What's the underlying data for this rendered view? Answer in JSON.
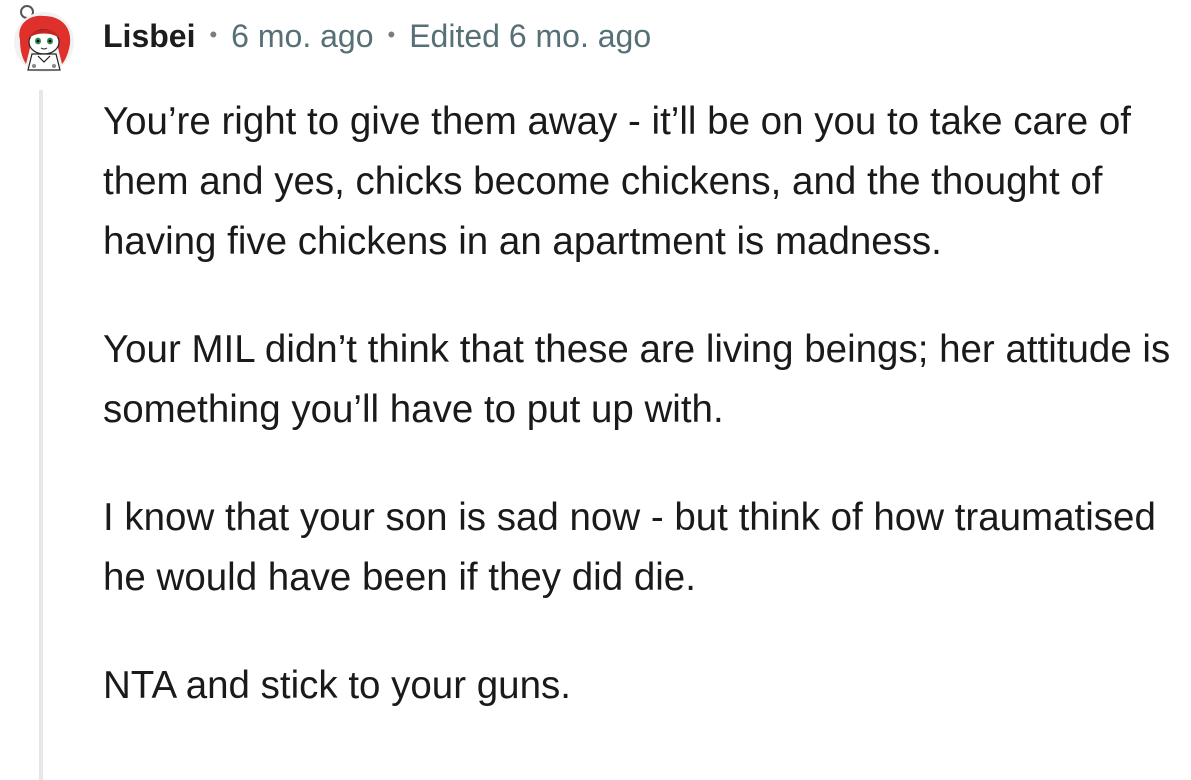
{
  "comment": {
    "author": "Lisbei",
    "separator": "•",
    "posted": "6 mo. ago",
    "edited": "Edited 6 mo. ago",
    "paragraphs": [
      "You’re right to give them away - it’ll be on you to take care of them and yes, chicks become chickens, and the thought of having five chickens in an apartment is madness.",
      "Your MIL didn’t think that these are living beings; her attitude is something you’ll have to put up with.",
      "I know that your son is sad now - but think of how traumatised he would have been if they did die.",
      "NTA and stick to your guns."
    ]
  },
  "avatar": {
    "icon": "snoo-avatar-icon",
    "hair_color": "#e0302b",
    "skin_color": "#ffffff"
  }
}
